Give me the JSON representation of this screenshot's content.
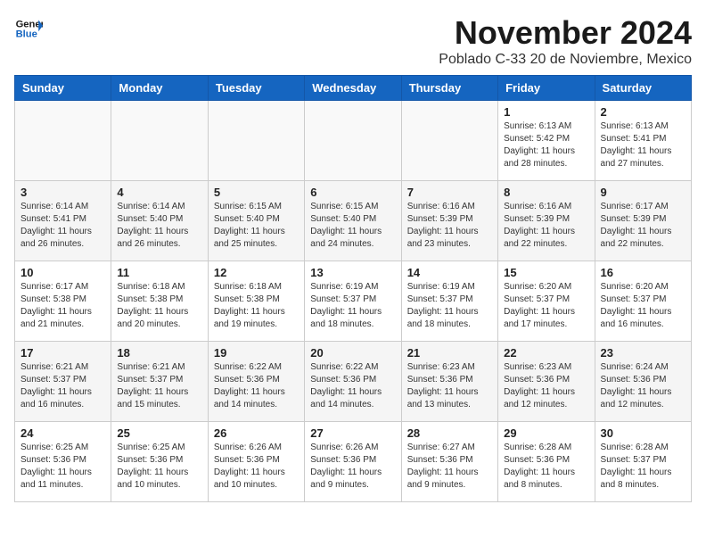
{
  "header": {
    "logo_line1": "General",
    "logo_line2": "Blue",
    "month_title": "November 2024",
    "subtitle": "Poblado C-33 20 de Noviembre, Mexico"
  },
  "days_of_week": [
    "Sunday",
    "Monday",
    "Tuesday",
    "Wednesday",
    "Thursday",
    "Friday",
    "Saturday"
  ],
  "weeks": [
    [
      {
        "day": "",
        "info": ""
      },
      {
        "day": "",
        "info": ""
      },
      {
        "day": "",
        "info": ""
      },
      {
        "day": "",
        "info": ""
      },
      {
        "day": "",
        "info": ""
      },
      {
        "day": "1",
        "info": "Sunrise: 6:13 AM\nSunset: 5:42 PM\nDaylight: 11 hours and 28 minutes."
      },
      {
        "day": "2",
        "info": "Sunrise: 6:13 AM\nSunset: 5:41 PM\nDaylight: 11 hours and 27 minutes."
      }
    ],
    [
      {
        "day": "3",
        "info": "Sunrise: 6:14 AM\nSunset: 5:41 PM\nDaylight: 11 hours and 26 minutes."
      },
      {
        "day": "4",
        "info": "Sunrise: 6:14 AM\nSunset: 5:40 PM\nDaylight: 11 hours and 26 minutes."
      },
      {
        "day": "5",
        "info": "Sunrise: 6:15 AM\nSunset: 5:40 PM\nDaylight: 11 hours and 25 minutes."
      },
      {
        "day": "6",
        "info": "Sunrise: 6:15 AM\nSunset: 5:40 PM\nDaylight: 11 hours and 24 minutes."
      },
      {
        "day": "7",
        "info": "Sunrise: 6:16 AM\nSunset: 5:39 PM\nDaylight: 11 hours and 23 minutes."
      },
      {
        "day": "8",
        "info": "Sunrise: 6:16 AM\nSunset: 5:39 PM\nDaylight: 11 hours and 22 minutes."
      },
      {
        "day": "9",
        "info": "Sunrise: 6:17 AM\nSunset: 5:39 PM\nDaylight: 11 hours and 22 minutes."
      }
    ],
    [
      {
        "day": "10",
        "info": "Sunrise: 6:17 AM\nSunset: 5:38 PM\nDaylight: 11 hours and 21 minutes."
      },
      {
        "day": "11",
        "info": "Sunrise: 6:18 AM\nSunset: 5:38 PM\nDaylight: 11 hours and 20 minutes."
      },
      {
        "day": "12",
        "info": "Sunrise: 6:18 AM\nSunset: 5:38 PM\nDaylight: 11 hours and 19 minutes."
      },
      {
        "day": "13",
        "info": "Sunrise: 6:19 AM\nSunset: 5:37 PM\nDaylight: 11 hours and 18 minutes."
      },
      {
        "day": "14",
        "info": "Sunrise: 6:19 AM\nSunset: 5:37 PM\nDaylight: 11 hours and 18 minutes."
      },
      {
        "day": "15",
        "info": "Sunrise: 6:20 AM\nSunset: 5:37 PM\nDaylight: 11 hours and 17 minutes."
      },
      {
        "day": "16",
        "info": "Sunrise: 6:20 AM\nSunset: 5:37 PM\nDaylight: 11 hours and 16 minutes."
      }
    ],
    [
      {
        "day": "17",
        "info": "Sunrise: 6:21 AM\nSunset: 5:37 PM\nDaylight: 11 hours and 16 minutes."
      },
      {
        "day": "18",
        "info": "Sunrise: 6:21 AM\nSunset: 5:37 PM\nDaylight: 11 hours and 15 minutes."
      },
      {
        "day": "19",
        "info": "Sunrise: 6:22 AM\nSunset: 5:36 PM\nDaylight: 11 hours and 14 minutes."
      },
      {
        "day": "20",
        "info": "Sunrise: 6:22 AM\nSunset: 5:36 PM\nDaylight: 11 hours and 14 minutes."
      },
      {
        "day": "21",
        "info": "Sunrise: 6:23 AM\nSunset: 5:36 PM\nDaylight: 11 hours and 13 minutes."
      },
      {
        "day": "22",
        "info": "Sunrise: 6:23 AM\nSunset: 5:36 PM\nDaylight: 11 hours and 12 minutes."
      },
      {
        "day": "23",
        "info": "Sunrise: 6:24 AM\nSunset: 5:36 PM\nDaylight: 11 hours and 12 minutes."
      }
    ],
    [
      {
        "day": "24",
        "info": "Sunrise: 6:25 AM\nSunset: 5:36 PM\nDaylight: 11 hours and 11 minutes."
      },
      {
        "day": "25",
        "info": "Sunrise: 6:25 AM\nSunset: 5:36 PM\nDaylight: 11 hours and 10 minutes."
      },
      {
        "day": "26",
        "info": "Sunrise: 6:26 AM\nSunset: 5:36 PM\nDaylight: 11 hours and 10 minutes."
      },
      {
        "day": "27",
        "info": "Sunrise: 6:26 AM\nSunset: 5:36 PM\nDaylight: 11 hours and 9 minutes."
      },
      {
        "day": "28",
        "info": "Sunrise: 6:27 AM\nSunset: 5:36 PM\nDaylight: 11 hours and 9 minutes."
      },
      {
        "day": "29",
        "info": "Sunrise: 6:28 AM\nSunset: 5:36 PM\nDaylight: 11 hours and 8 minutes."
      },
      {
        "day": "30",
        "info": "Sunrise: 6:28 AM\nSunset: 5:37 PM\nDaylight: 11 hours and 8 minutes."
      }
    ]
  ]
}
